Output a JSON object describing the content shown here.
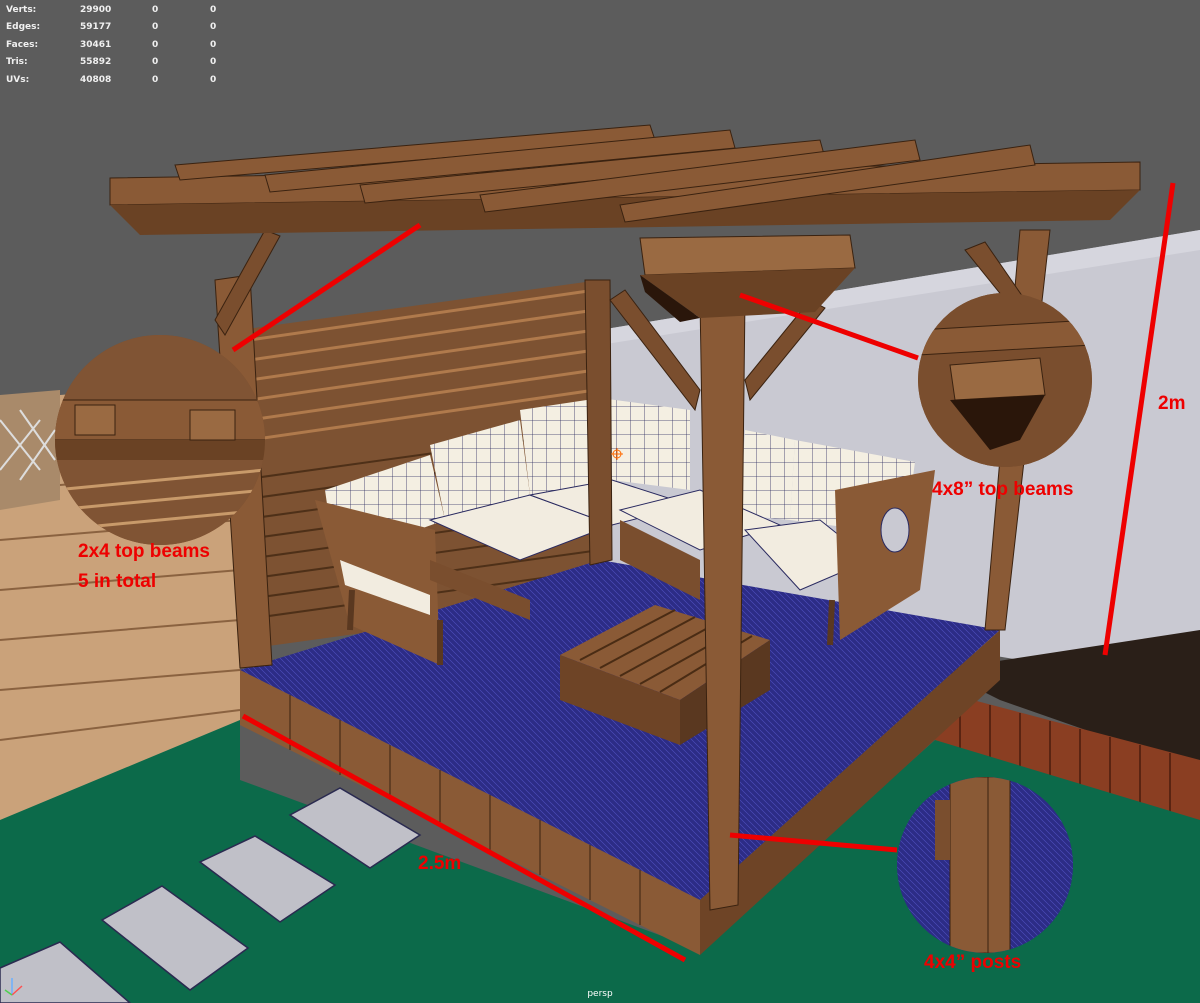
{
  "hud": {
    "rows": [
      {
        "label": "Verts:",
        "total": "29900",
        "sel": "0",
        "sel2": "0"
      },
      {
        "label": "Edges:",
        "total": "59177",
        "sel": "0",
        "sel2": "0"
      },
      {
        "label": "Faces:",
        "total": "30461",
        "sel": "0",
        "sel2": "0"
      },
      {
        "label": "Tris:",
        "total": "55892",
        "sel": "0",
        "sel2": "0"
      },
      {
        "label": "UVs:",
        "total": "40808",
        "sel": "0",
        "sel2": "0"
      }
    ]
  },
  "annotations": {
    "top_beams_2x4": "2x4 top beams",
    "total_count": "5 in total",
    "top_beams_4x8": "4x8” top beams",
    "height": "2m",
    "width": "2.5m",
    "posts": "4x4” posts"
  },
  "camera_label": "persp",
  "colors": {
    "viewport_bg": "#5c5c5c",
    "wood": "#8a5a36",
    "wood_dark": "#5e3a20",
    "deck": "#2a2a7a",
    "grass": "#0e6a4a",
    "wall": "#c8c8d0",
    "cushion": "#f4efe2",
    "annotation": "#ee0000"
  }
}
